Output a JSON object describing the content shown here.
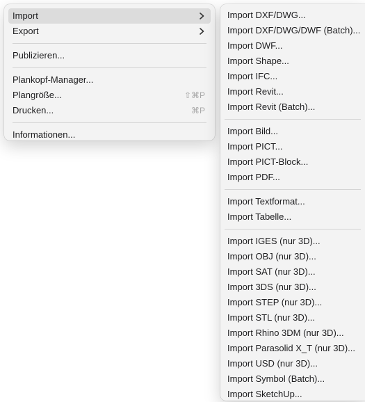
{
  "main_menu": {
    "import": "Import",
    "export": "Export",
    "publish": "Publizieren...",
    "titleblock_manager": "Plankopf-Manager...",
    "sheet_size": "Plangröße...",
    "sheet_size_shortcut": "⇧⌘P",
    "print": "Drucken...",
    "print_shortcut": "⌘P",
    "info": "Informationen..."
  },
  "import_menu": {
    "items": [
      "Import DXF/DWG...",
      "Import DXF/DWG/DWF (Batch)...",
      "Import DWF...",
      "Import Shape...",
      "Import IFC...",
      "Import Revit...",
      "Import Revit (Batch)...",
      "Import Bild...",
      "Import PICT...",
      "Import PICT-Block...",
      "Import PDF...",
      "Import Textformat...",
      "Import Tabelle...",
      "Import IGES (nur 3D)...",
      "Import OBJ (nur 3D)...",
      "Import SAT (nur 3D)...",
      "Import 3DS (nur 3D)...",
      "Import STEP (nur 3D)...",
      "Import STL (nur 3D)...",
      "Import Rhino 3DM (nur 3D)...",
      "Import Parasolid X_T (nur 3D)...",
      "Import USD (nur 3D)...",
      "Import Symbol (Batch)...",
      "Import SketchUp..."
    ]
  }
}
